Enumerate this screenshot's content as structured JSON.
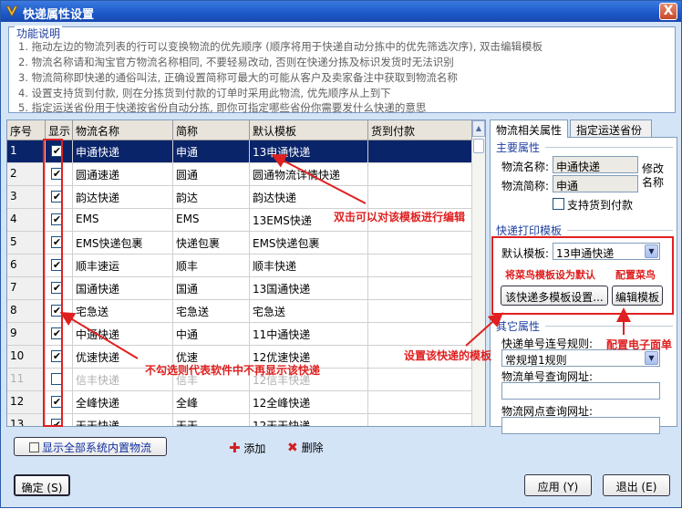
{
  "window": {
    "title": "快递属性设置",
    "close_label": "X"
  },
  "info": {
    "legend": "功能说明",
    "lines": [
      "1. 拖动左边的物流列表的行可以变换物流的优先顺序 (顺序将用于快递自动分拣中的优先筛选次序), 双击编辑模板",
      "2. 物流名称请和淘宝官方物流名称相同, 不要轻易改动, 否则在快递分拣及标识发货时无法识别",
      "3. 物流简称即快递的通俗叫法, 正确设置简称可最大的可能从客户及卖家备注中获取到物流名称",
      "4. 设置支持货到付款, 则在分拣货到付款的订单时采用此物流, 优先顺序从上到下",
      "5. 指定运送省份用于快递按省份自动分拣, 即你可指定哪些省份你需要发什么快递的意思"
    ]
  },
  "grid": {
    "headers": [
      "序号",
      "显示",
      "物流名称",
      "简称",
      "默认模板",
      "货到付款"
    ],
    "rows": [
      {
        "no": "1",
        "checked": true,
        "name": "申通快递",
        "short": "申通",
        "template": "13申通快递",
        "cod": "",
        "selected": true,
        "disabled": false
      },
      {
        "no": "2",
        "checked": true,
        "name": "圆通速递",
        "short": "圆通",
        "template": "圆通物流详情快递",
        "cod": "",
        "selected": false,
        "disabled": false
      },
      {
        "no": "3",
        "checked": true,
        "name": "韵达快递",
        "short": "韵达",
        "template": "韵达快递",
        "cod": "",
        "selected": false,
        "disabled": false
      },
      {
        "no": "4",
        "checked": true,
        "name": "EMS",
        "short": "EMS",
        "template": "13EMS快递",
        "cod": "",
        "selected": false,
        "disabled": false
      },
      {
        "no": "5",
        "checked": true,
        "name": "EMS快递包裹",
        "short": "快递包裹",
        "template": "EMS快递包裹",
        "cod": "",
        "selected": false,
        "disabled": false
      },
      {
        "no": "6",
        "checked": true,
        "name": "顺丰速运",
        "short": "顺丰",
        "template": "顺丰快递",
        "cod": "",
        "selected": false,
        "disabled": false
      },
      {
        "no": "7",
        "checked": true,
        "name": "国通快递",
        "short": "国通",
        "template": "13国通快递",
        "cod": "",
        "selected": false,
        "disabled": false
      },
      {
        "no": "8",
        "checked": true,
        "name": "宅急送",
        "short": "宅急送",
        "template": "宅急送",
        "cod": "",
        "selected": false,
        "disabled": false
      },
      {
        "no": "9",
        "checked": true,
        "name": "中通快递",
        "short": "中通",
        "template": "11中通快递",
        "cod": "",
        "selected": false,
        "disabled": false
      },
      {
        "no": "10",
        "checked": true,
        "name": "优速快递",
        "short": "优速",
        "template": "12优速快递",
        "cod": "",
        "selected": false,
        "disabled": false
      },
      {
        "no": "11",
        "checked": false,
        "name": "信丰快递",
        "short": "信丰",
        "template": "12信丰快递",
        "cod": "",
        "selected": false,
        "disabled": true
      },
      {
        "no": "12",
        "checked": true,
        "name": "全峰快递",
        "short": "全峰",
        "template": "12全峰快递",
        "cod": "",
        "selected": false,
        "disabled": false
      },
      {
        "no": "13",
        "checked": true,
        "name": "天天快递",
        "short": "天天",
        "template": "12天天快递",
        "cod": "",
        "selected": false,
        "disabled": false
      }
    ]
  },
  "bottom": {
    "show_all_label": "显示全部系统内置物流",
    "add_label": "添加",
    "delete_label": "删除",
    "ok_label": "确定 (S)",
    "apply_label": "应用 (Y)",
    "exit_label": "退出 (E)"
  },
  "tabs": {
    "active": "物流相关属性",
    "other": "指定运送省份"
  },
  "main_props": {
    "title": "主要属性",
    "name_label": "物流名称:",
    "name_value": "申通快递",
    "short_label": "物流简称:",
    "short_value": "申通",
    "modify_label": "修改名称",
    "cod_label": "支持货到付款"
  },
  "print": {
    "title": "快递打印模板",
    "default_label": "默认模板:",
    "default_value": "13申通快递",
    "multi_btn": "该快递多模板设置...",
    "edit_btn": "编辑模板"
  },
  "other": {
    "title": "其它属性",
    "rule_label": "快递单号连号规则:",
    "rule_value": "常规增1规则",
    "query_label": "物流单号查询网址:",
    "query_value": "",
    "site_label": "物流网点查询网址:",
    "site_value": ""
  },
  "annotations": {
    "dblclick": "双击可以对该模板进行编辑",
    "uncheck": "不勾选则代表软件中不再显示该快递",
    "set_multi": "设置该快递的模板",
    "cainiao": "将菜鸟模板设为默认",
    "config_cainiao": "配置菜鸟",
    "config_ebill": "配置电子面单"
  }
}
